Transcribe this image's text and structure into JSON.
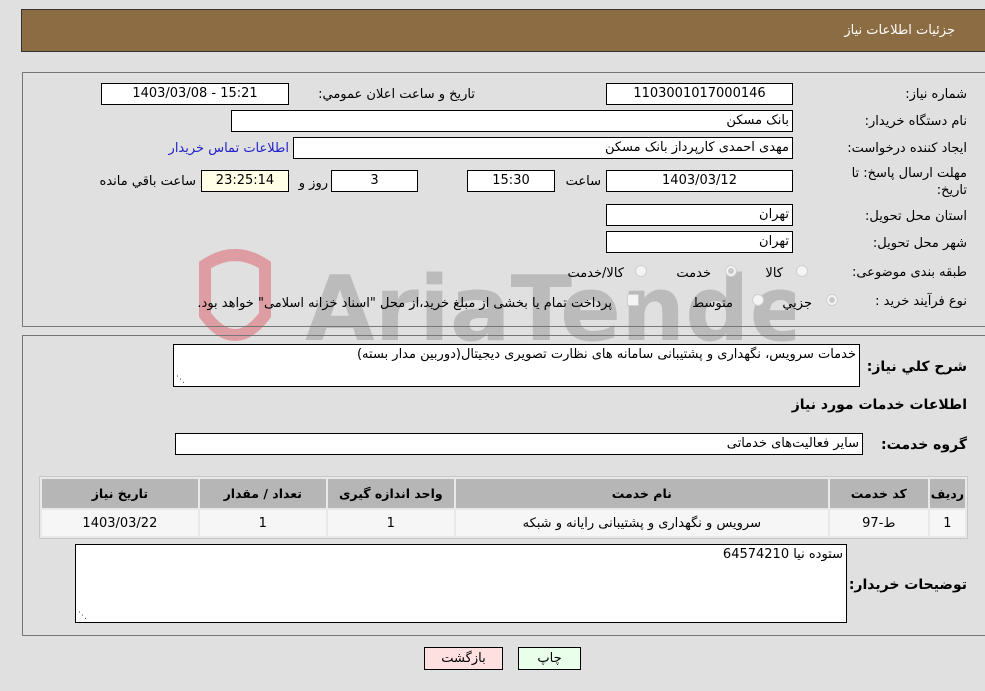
{
  "header": {
    "title": "جزئیات اطلاعات نیاز"
  },
  "form": {
    "need_number": {
      "label": "شماره نیاز:",
      "value": "1103001017000146"
    },
    "announce_datetime": {
      "label": "تاریخ و ساعت اعلان عمومي:",
      "value": "1403/03/08 - 15:21"
    },
    "buyer_org": {
      "label": "نام دستگاه خریدار:",
      "value": "بانک مسکن"
    },
    "requester": {
      "label": "ایجاد کننده درخواست:",
      "value": "مهدی احمدی کارپرداز بانک مسکن"
    },
    "buyer_contact_link": "اطلاعات تماس خریدار",
    "deadline": {
      "label_line1": "مهلت ارسال پاسخ: تا",
      "label_line2": "تاریخ:",
      "date": "1403/03/12",
      "time_label": "ساعت",
      "time": "15:30",
      "days": "3",
      "days_label": "روز و",
      "remaining": "23:25:14",
      "remaining_label": "ساعت باقي مانده"
    },
    "province": {
      "label": "استان محل تحویل:",
      "value": "تهران"
    },
    "city": {
      "label": "شهر محل تحویل:",
      "value": "تهران"
    },
    "category": {
      "label": "طبقه بندی موضوعی:",
      "options": [
        {
          "label": "کالا",
          "selected": false
        },
        {
          "label": "خدمت",
          "selected": true
        },
        {
          "label": "کالا/خدمت",
          "selected": false
        }
      ]
    },
    "purchase_process": {
      "label": "نوع فرآیند خرید :",
      "options": [
        {
          "label": "جزيي",
          "selected": true
        },
        {
          "label": "متوسط",
          "selected": false
        }
      ],
      "treasury_checkbox_label": "پرداخت تمام یا بخشی از مبلغ خرید،از محل \"اسناد خزانه اسلامی\" خواهد بود.",
      "treasury_checked": false
    }
  },
  "details": {
    "description_label": "شرح کلي نیاز:",
    "description": "خدمات سرویس، نگهداری و پشتیبانی سامانه های نظارت تصویری دیجیتال(دوربین مدار بسته)",
    "services_title": "اطلاعات خدمات مورد نیاز",
    "service_group_label": "گروه خدمت:",
    "service_group": "سایر فعالیت‌های خدماتی",
    "table": {
      "headers": [
        "ردیف",
        "کد خدمت",
        "نام خدمت",
        "واحد اندازه گیری",
        "تعداد / مقدار",
        "تاریخ نیاز"
      ],
      "rows": [
        [
          "1",
          "ط-97",
          "سرویس و نگهداری و پشتیبانی رایانه و شبکه",
          "1",
          "1",
          "1403/03/22"
        ]
      ]
    },
    "buyer_notes_label": "توضیحات خریدار:",
    "buyer_notes": "ستوده نیا 64574210"
  },
  "buttons": {
    "print": "چاپ",
    "back": "بازگشت"
  },
  "watermark": "AriaTender.neT",
  "colors": {
    "header_bg": "#8c6c42",
    "print_bg": "#eaffea",
    "back_bg": "#ffe0e0",
    "link": "#2222cc"
  }
}
